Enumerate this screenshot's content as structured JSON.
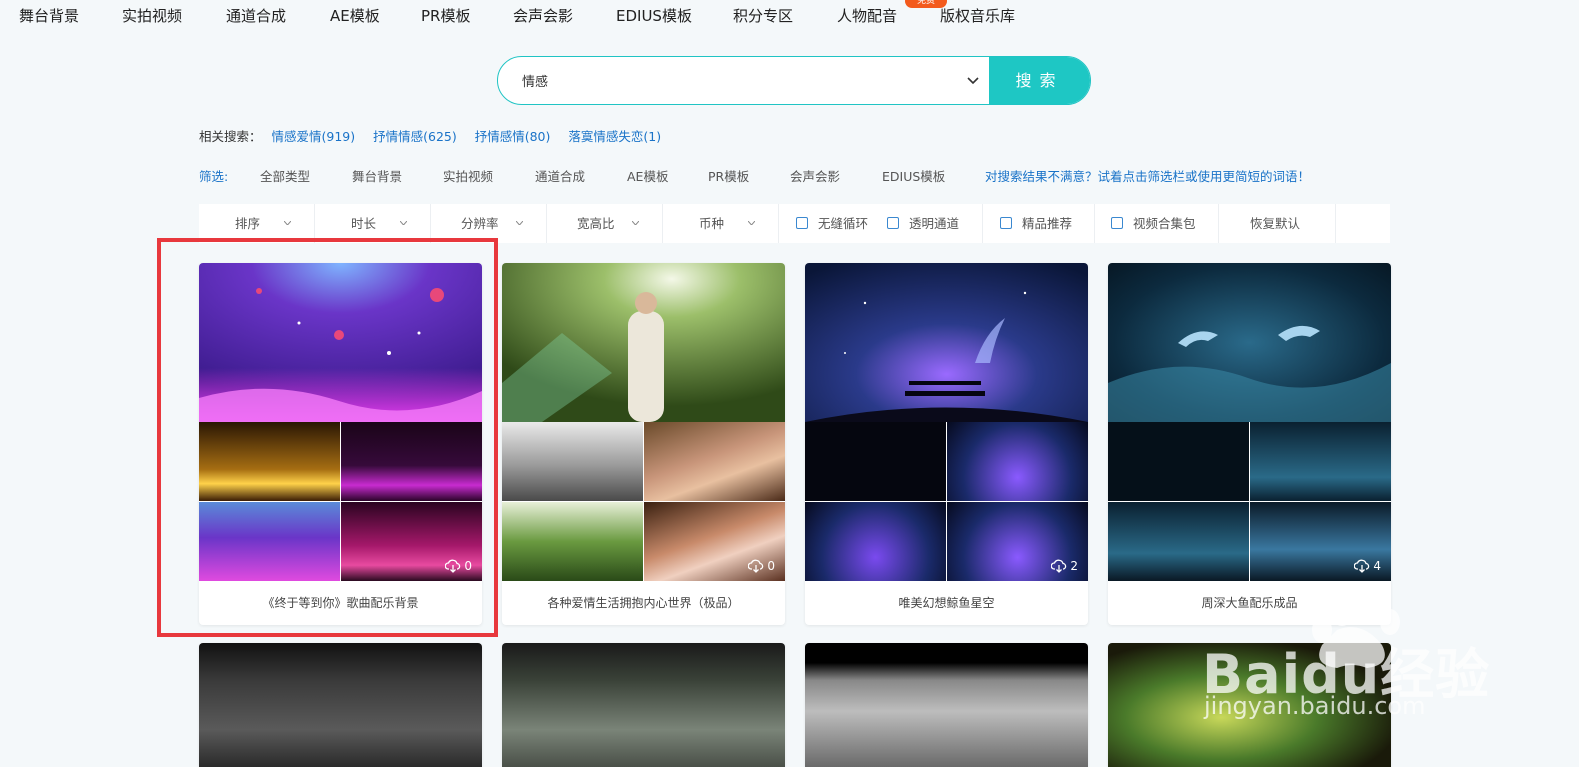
{
  "nav": {
    "items": [
      "舞台背景",
      "实拍视频",
      "通道合成",
      "AE模板",
      "PR模板",
      "会声会影",
      "EDIUS模板",
      "积分专区",
      "人物配音",
      "版权音乐库"
    ],
    "hot_badge": "免费"
  },
  "search": {
    "value": "情感",
    "button": "搜索"
  },
  "related": {
    "label": "相关搜索：",
    "links": [
      "情感爱情(919)",
      "抒情情感(625)",
      "抒情感情(80)",
      "落寞情感失恋(1)"
    ]
  },
  "filter": {
    "label": "筛选:",
    "items": [
      "全部类型",
      "舞台背景",
      "实拍视频",
      "通道合成",
      "AE模板",
      "PR模板",
      "会声会影",
      "EDIUS模板"
    ],
    "hint": "对搜索结果不满意？试着点击筛选栏或使用更简短的词语！"
  },
  "sortbar": {
    "dropdowns": [
      "排序",
      "时长",
      "分辨率",
      "宽高比",
      "币种"
    ],
    "checkboxes": [
      "无缝循环",
      "透明通道",
      "精品推荐",
      "视频合集包"
    ],
    "reset": "恢复默认"
  },
  "cards": [
    {
      "title": "《终于等到你》歌曲配乐背景",
      "downloads": "0"
    },
    {
      "title": "各种爱情生活拥抱内心世界（极品）",
      "downloads": "0"
    },
    {
      "title": "唯美幻想鲸鱼星空",
      "downloads": "2"
    },
    {
      "title": "周深大鱼配乐成品",
      "downloads": "4"
    }
  ],
  "watermark": {
    "brand": "Baidu经验",
    "url": "jingyan.baidu.com"
  },
  "colors": {
    "accent": "#1ec7c4",
    "link": "#1a73c8",
    "highlight": "#e8383d",
    "badge": "#f35a1c"
  }
}
